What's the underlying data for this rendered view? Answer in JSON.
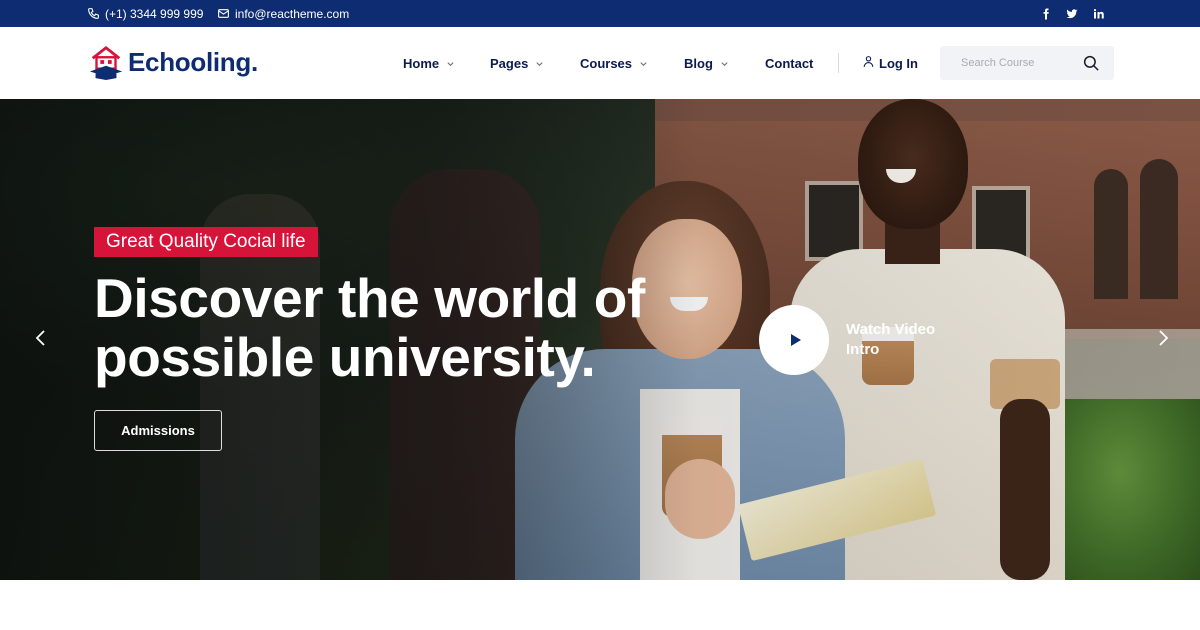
{
  "topbar": {
    "phone": "(+1) 3344 999 999",
    "email": "info@reactheme.com",
    "socials": [
      "facebook-icon",
      "twitter-icon",
      "linkedin-icon"
    ]
  },
  "header": {
    "logo_text": "Echooling",
    "logo_dot": ".",
    "nav": [
      {
        "label": "Home",
        "dropdown": true
      },
      {
        "label": "Pages",
        "dropdown": true
      },
      {
        "label": "Courses",
        "dropdown": true
      },
      {
        "label": "Blog",
        "dropdown": true
      },
      {
        "label": "Contact",
        "dropdown": false
      }
    ],
    "login_label": "Log In",
    "search_placeholder": "Search Course"
  },
  "hero": {
    "badge": "Great Quality Cocial life",
    "title_line1": "Discover the world of",
    "title_line2": "possible university.",
    "cta_label": "Admissions",
    "video_label_line1": "Watch Video",
    "video_label_line2": "Intro"
  },
  "colors": {
    "brand_navy": "#0e2c72",
    "accent_red": "#d6143a",
    "text_dark": "#0b1b4d"
  }
}
